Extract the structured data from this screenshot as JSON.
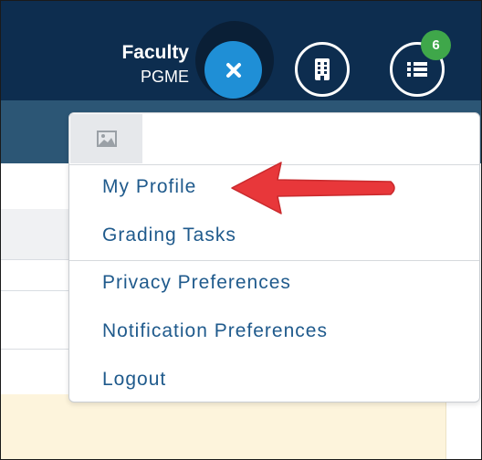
{
  "header": {
    "user_name": "Faculty",
    "user_role": "PGME",
    "notification_count": "6"
  },
  "menu": {
    "items": [
      {
        "label": "My Profile"
      },
      {
        "label": "Grading Tasks"
      },
      {
        "label": "Privacy Preferences"
      },
      {
        "label": "Notification Preferences"
      },
      {
        "label": "Logout"
      }
    ]
  },
  "icons": {
    "close": "close-icon",
    "organization": "building-icon",
    "list": "list-icon",
    "avatar": "image-placeholder-icon",
    "annotation": "red-arrow"
  },
  "colors": {
    "header_bg": "#0d2d4f",
    "close_button": "#1f8fd6",
    "badge": "#3fa74a",
    "menu_text": "#1f5a8c",
    "annotation_arrow": "#e8373a"
  }
}
